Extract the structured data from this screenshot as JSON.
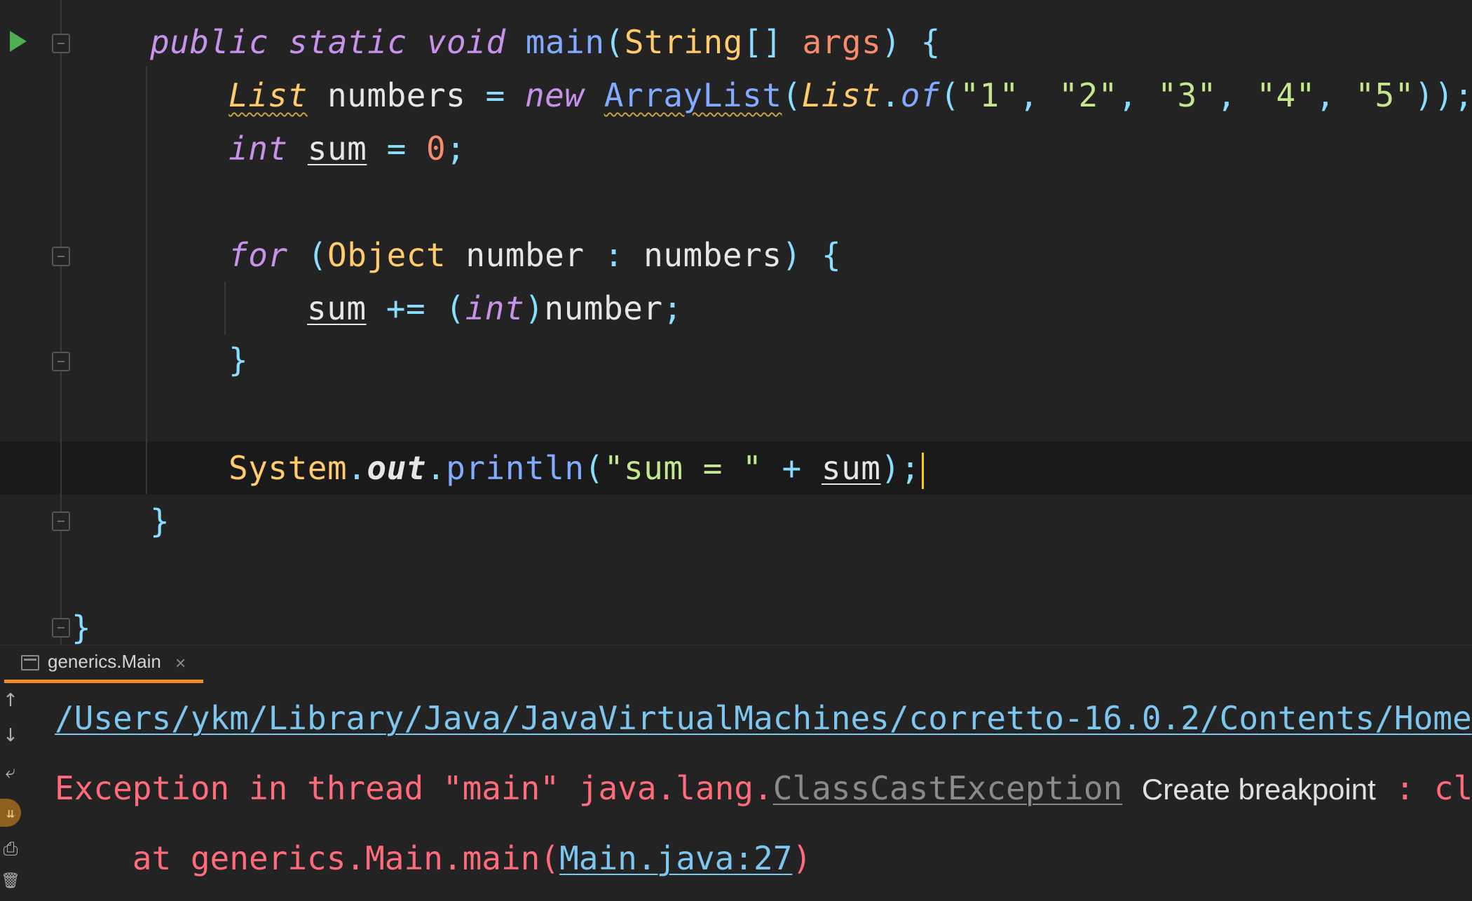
{
  "editor": {
    "lines": {
      "main_sig": {
        "public": "public",
        "static": "static",
        "void": "void",
        "name": "main",
        "lp": "(",
        "type": "String",
        "arr": "[]",
        "param": "args",
        "rp": ")",
        "brace": "{"
      },
      "list_decl": {
        "type": "List",
        "var": "numbers",
        "eq": "=",
        "new": "new",
        "cls": "ArrayList",
        "lp": "(",
        "type2": "List",
        "dot": ".",
        "of": "of",
        "lp2": "(",
        "s1": "\"1\"",
        "c1": ",",
        "s2": "\"2\"",
        "c2": ",",
        "s3": "\"3\"",
        "c3": ",",
        "s4": "\"4\"",
        "c4": ",",
        "s5": "\"5\"",
        "end": "));"
      },
      "sum_decl": {
        "type": "int",
        "var": "sum",
        "eq": "=",
        "val": "0",
        "semi": ";"
      },
      "for_line": {
        "kw": "for",
        "lp": "(",
        "type": "Object",
        "var": "number",
        "colon": ":",
        "iter": "numbers",
        "rp": ")",
        "brace": "{"
      },
      "sum_add": {
        "var": "sum",
        "op": "+=",
        "lp": "(",
        "cast": "int",
        "rp": ")",
        "var2": "number",
        "semi": ";"
      },
      "close_for": "}",
      "println": {
        "sys": "System",
        "dot1": ".",
        "out": "out",
        "dot2": ".",
        "fn": "println",
        "lp": "(",
        "str": "\"sum = \"",
        "plus": "+",
        "var": "sum",
        "end": ");"
      },
      "close_main": "}",
      "close_class": "}"
    }
  },
  "run_panel": {
    "tab_label": "generics.Main",
    "tab_close": "×",
    "toolbar": {
      "up_icon": "↑",
      "down_icon": "↓",
      "wrap_icon": "⤶",
      "scroll_icon": "⇊",
      "print_icon": "⎙",
      "trash_icon": "🗑"
    },
    "console": {
      "path": "/Users/ykm/Library/Java/JavaVirtualMachines/corretto-16.0.2/Contents/Home",
      "exception_prefix": "Exception in thread \"main\" java.lang.",
      "exception_class": "ClassCastException",
      "create_breakpoint": "Create breakpoint",
      "exception_suffix": " : cl",
      "at_prefix": "    at generics.Main.main(",
      "at_link": "Main.java:27",
      "at_suffix": ")"
    }
  },
  "colors": {
    "accent_tab": "#f28c28",
    "run_icon": "#4caf50",
    "error": "#ff6b7a",
    "link": "#7cc6f0"
  }
}
